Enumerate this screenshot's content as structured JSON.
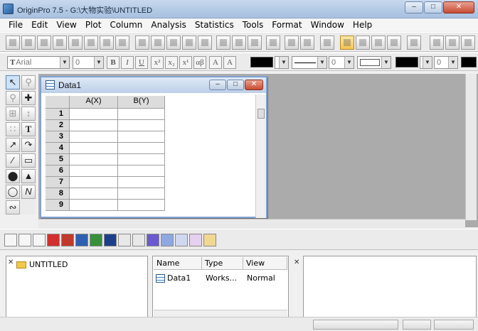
{
  "window": {
    "title": "OriginPro 7.5 - G:\\大物实验\\UNTITLED"
  },
  "menu": [
    "File",
    "Edit",
    "View",
    "Plot",
    "Column",
    "Analysis",
    "Statistics",
    "Tools",
    "Format",
    "Window",
    "Help"
  ],
  "format_toolbar": {
    "font": "Arial",
    "size": "0",
    "line_width": "0",
    "box_width": "0"
  },
  "worksheet": {
    "title": "Data1",
    "columns": [
      "A(X)",
      "B(Y)"
    ],
    "rows": [
      "1",
      "2",
      "3",
      "4",
      "5",
      "6",
      "7",
      "8",
      "9"
    ]
  },
  "explorer": {
    "folder": "UNTITLED",
    "columns": [
      "Name",
      "Type",
      "View"
    ],
    "items": [
      {
        "name": "Data1",
        "type": "Works...",
        "view": "Normal"
      }
    ]
  }
}
